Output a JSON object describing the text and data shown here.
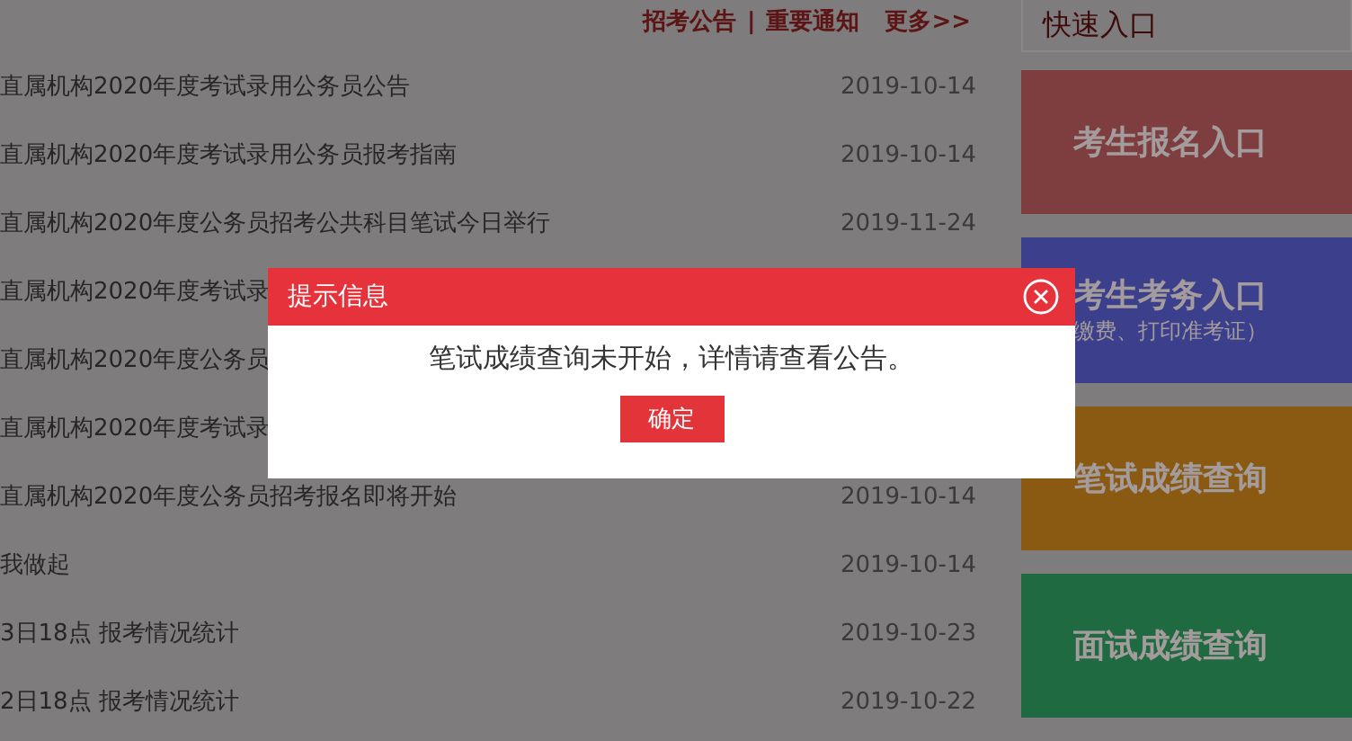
{
  "notice_links": {
    "tabs": [
      "招考公告",
      "重要通知"
    ],
    "separator": "|",
    "more": "更多>>"
  },
  "news": [
    {
      "title": "直属机构2020年度考试录用公务员公告",
      "date": "2019-10-14"
    },
    {
      "title": "直属机构2020年度考试录用公务员报考指南",
      "date": "2019-10-14"
    },
    {
      "title": "直属机构2020年度公务员招考公共科目笔试今日举行",
      "date": "2019-11-24"
    },
    {
      "title": "直属机构2020年度考试录"
    },
    {
      "title": "直属机构2020年度公务员"
    },
    {
      "title": "直属机构2020年度考试录"
    },
    {
      "title": "直属机构2020年度公务员招考报名即将开始",
      "date": "2019-10-14"
    },
    {
      "title": "我做起",
      "date": "2019-10-14"
    },
    {
      "title": "3日18点 报考情况统计",
      "date": "2019-10-23"
    },
    {
      "title": "2日18点 报考情况统计",
      "date": "2019-10-22"
    }
  ],
  "quick_entry": {
    "title": "快速入口",
    "cards": [
      {
        "label": "考生报名入口",
        "color": "#7e3d3f"
      },
      {
        "label": "考生考务入口",
        "sublabel": "缴费、打印准考证）",
        "color": "#3b3f8c"
      },
      {
        "label": "笔试成绩查询",
        "color": "#8a5a12"
      },
      {
        "label": "面试成绩查询",
        "color": "#1f6a40"
      }
    ]
  },
  "dialog": {
    "title": "提示信息",
    "message": "笔试成绩查询未开始，详情请查看公告。",
    "button": "确定"
  }
}
